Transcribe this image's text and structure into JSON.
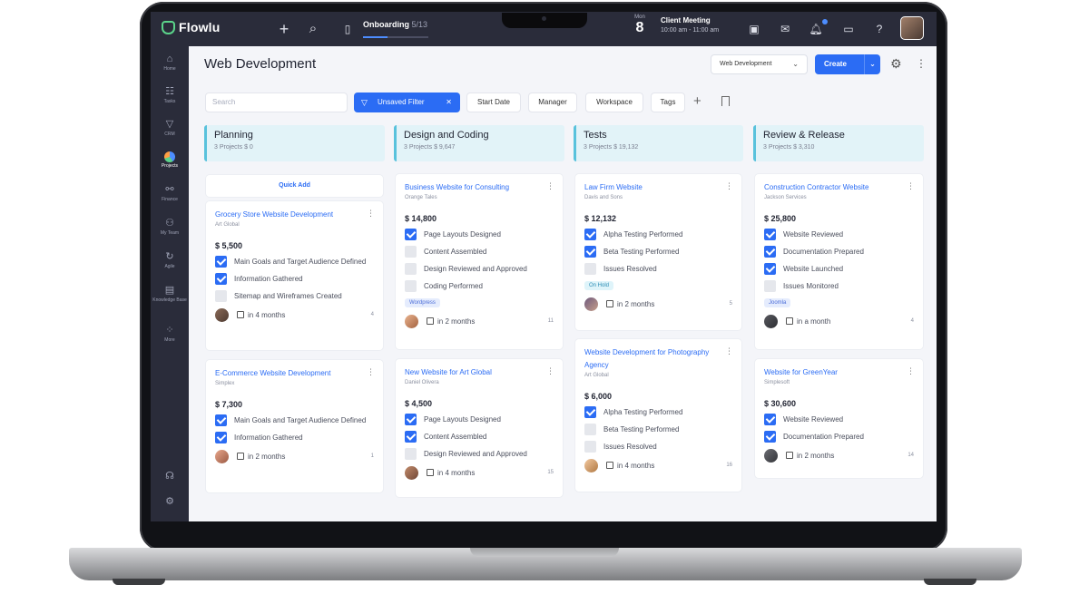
{
  "app": {
    "name": "Flowlu"
  },
  "topbar": {
    "onboarding_label": "Onboarding",
    "onboarding_count": "5/13",
    "onboarding_progress": 0.38,
    "date_month": "Mon",
    "date_day": "8",
    "meeting_title": "Client Meeting",
    "meeting_time": "10:00 am - 11:00 am"
  },
  "sidebar": {
    "items": [
      {
        "label": "Home",
        "icon": "home-icon"
      },
      {
        "label": "Tasks",
        "icon": "tasks-icon"
      },
      {
        "label": "CRM",
        "icon": "crm-funnel-icon"
      },
      {
        "label": "Projects",
        "icon": "projects-icon"
      },
      {
        "label": "Finance",
        "icon": "finance-icon"
      },
      {
        "label": "My Team",
        "icon": "team-icon"
      },
      {
        "label": "Agile",
        "icon": "agile-icon"
      },
      {
        "label": "Knowledge Base",
        "icon": "knowledge-base-icon"
      },
      {
        "label": "More",
        "icon": "more-icon"
      }
    ]
  },
  "header": {
    "title": "Web Development",
    "workspace_select": "Web Development",
    "create_label": "Create"
  },
  "filters": {
    "search_placeholder": "Search",
    "unsaved_filter": "Unsaved Filter",
    "start_date": "Start Date",
    "manager": "Manager",
    "workspace": "Workspace",
    "tags": "Tags"
  },
  "columns": [
    {
      "title": "Planning",
      "meta": "3 Projects  $ 0"
    },
    {
      "title": "Design and Coding",
      "meta": "3 Projects  $ 9,647"
    },
    {
      "title": "Tests",
      "meta": "3 Projects  $ 19,132"
    },
    {
      "title": "Review & Release",
      "meta": "3 Projects  $ 3,310"
    }
  ],
  "quick_add": "Quick Add",
  "cards": {
    "c1": {
      "title": "Grocery Store Website Development",
      "client": "Art Global",
      "amount": "$ 5,500",
      "tasks": [
        "Main Goals and Target Audience Defined",
        "Information Gathered",
        "Sitemap and Wireframes Created"
      ],
      "due": "in 4 months",
      "subs": "4"
    },
    "c2": {
      "title": "E-Commerce Website Development",
      "client": "Simplex",
      "amount": "$ 7,300",
      "tasks": [
        "Main Goals and Target Audience Defined",
        "Information Gathered"
      ],
      "due": "in 2 months",
      "subs": "1"
    },
    "c3": {
      "title": "Business Website for Consulting",
      "client": "Orange Tales",
      "amount": "$ 14,800",
      "tasks": [
        "Page Layouts Designed",
        "Content Assembled",
        "Design Reviewed and Approved",
        "Coding Performed"
      ],
      "tag": "Wordpress",
      "due": "in 2 months",
      "subs": "11"
    },
    "c4": {
      "title": "New Website for Art Global",
      "client": "Daniel Olivera",
      "amount": "$ 4,500",
      "tasks": [
        "Page Layouts Designed",
        "Content Assembled",
        "Design Reviewed and Approved"
      ],
      "due": "in 4 months",
      "subs": "15"
    },
    "c5": {
      "title": "Law Firm Website",
      "client": "Davis and Sons",
      "amount": "$ 12,132",
      "tasks": [
        "Alpha Testing Performed",
        "Beta Testing Performed",
        "Issues Resolved"
      ],
      "tag": "On Hold",
      "due": "in 2 months",
      "subs": "5"
    },
    "c6": {
      "title": "Website Development for Photography Agency",
      "client": "Art Global",
      "amount": "$ 6,000",
      "tasks": [
        "Alpha Testing Performed",
        "Beta Testing Performed",
        "Issues Resolved"
      ],
      "due": "in 4 months",
      "subs": "16"
    },
    "c7": {
      "title": "Construction Contractor Website",
      "client": "Jackson Services",
      "amount": "$ 25,800",
      "tasks": [
        "Website Reviewed",
        "Documentation Prepared",
        "Website Launched",
        "Issues Monitored"
      ],
      "tag": "Joomla",
      "due": "in a month",
      "subs": "4"
    },
    "c8": {
      "title": "Website for GreenYear",
      "client": "Simplesoft",
      "amount": "$ 30,600",
      "tasks": [
        "Website Reviewed",
        "Documentation Prepared"
      ],
      "due": "in 2 months",
      "subs": "14"
    }
  },
  "colors": {
    "accent": "#2b6cf4",
    "sidebar": "#2a2c3a",
    "column_header": "#e2f3f8"
  }
}
